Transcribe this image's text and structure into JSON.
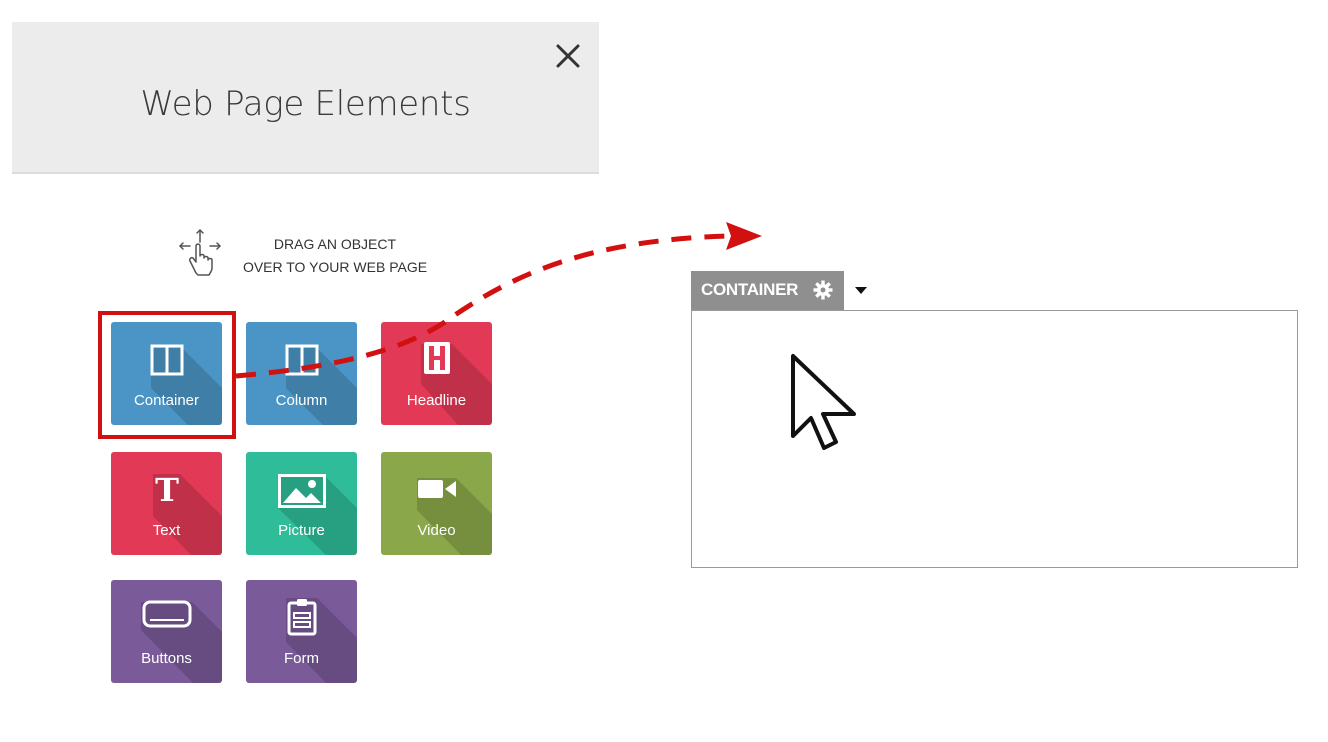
{
  "panel": {
    "title": "Web Page Elements"
  },
  "drag_hint": {
    "line1": "DRAG AN OBJECT",
    "line2": "OVER TO YOUR WEB PAGE"
  },
  "tiles": [
    {
      "label": "Container",
      "color": "#4a95c5"
    },
    {
      "label": "Column",
      "color": "#4a95c5"
    },
    {
      "label": "Headline",
      "color": "#e23a56"
    },
    {
      "label": "Text",
      "color": "#e23a56"
    },
    {
      "label": "Picture",
      "color": "#2ebc99"
    },
    {
      "label": "Video",
      "color": "#8aa84a"
    },
    {
      "label": "Buttons",
      "color": "#7a5a98"
    },
    {
      "label": "Form",
      "color": "#7a5a98"
    }
  ],
  "canvas": {
    "container_label": "CONTAINER"
  },
  "colors": {
    "selection": "#d31010",
    "tab": "#8f8f8f",
    "arrow": "#d31010"
  }
}
